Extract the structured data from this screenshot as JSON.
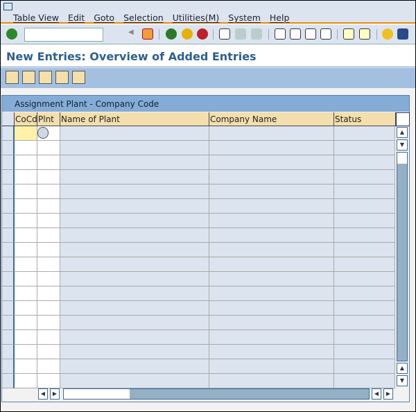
{
  "menu": [
    "Table View",
    "Edit",
    "Goto",
    "Selection",
    "Utilities(M)",
    "System",
    "Help"
  ],
  "command_field": {
    "value": ""
  },
  "title": "New Entries: Overview of Added Entries",
  "table": {
    "title": "Assignment Plant - Company Code",
    "columns": [
      "CoCd",
      "Plnt",
      "Name of Plant",
      "Company Name",
      "Status"
    ],
    "row_count": 18,
    "rows": []
  },
  "colors": {
    "title": "#2e5f8f",
    "accent": "#f08c00",
    "header": "#f3dfad",
    "readonly_cell": "#dbe4ef"
  }
}
